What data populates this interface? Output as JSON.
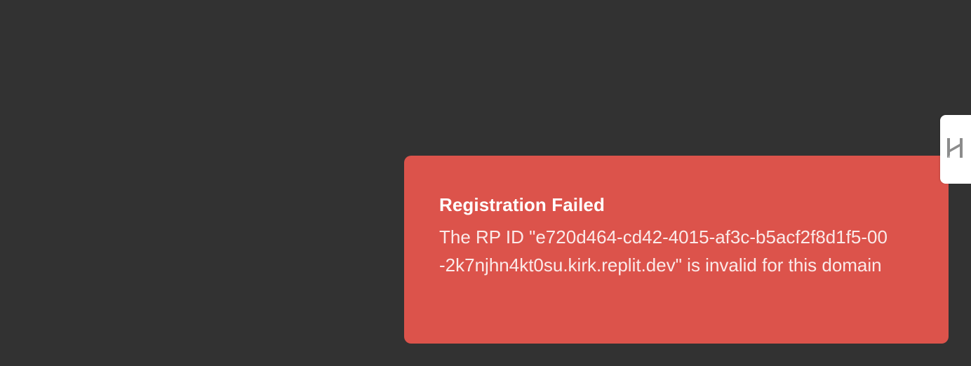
{
  "toast": {
    "title": "Registration Failed",
    "message": "The RP ID \"e720d464-cd42-4015-af3c-b5acf2f8d1f5-00-2k7njhn4kt0su.kirk.replit.dev\" is invalid for this domain",
    "background_color": "#dc534b"
  },
  "side_tab": {
    "icon": "hanko-logo-icon"
  },
  "page": {
    "background_color": "#323232"
  }
}
